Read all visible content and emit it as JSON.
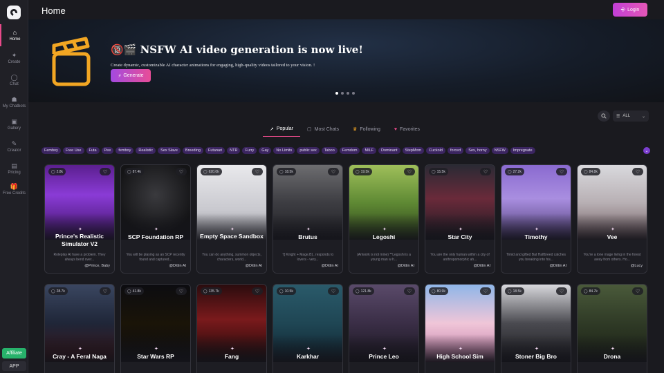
{
  "sidebar": {
    "items": [
      {
        "label": "Home",
        "icon": "home-icon",
        "glyph": "⌂"
      },
      {
        "label": "Create",
        "icon": "sparkle-icon",
        "glyph": "✦"
      },
      {
        "label": "Chat",
        "icon": "chat-icon",
        "glyph": "◯"
      },
      {
        "label": "My Chatbots",
        "icon": "bot-icon",
        "glyph": "☗"
      },
      {
        "label": "Gallery",
        "icon": "gallery-icon",
        "glyph": "▣"
      },
      {
        "label": "Creator",
        "icon": "creator-icon",
        "glyph": "✎"
      },
      {
        "label": "Pricing",
        "icon": "pricing-icon",
        "glyph": "▤"
      },
      {
        "label": "Free Credits",
        "icon": "gift-icon",
        "glyph": "🎁"
      }
    ],
    "affiliate_label": "Affiliate",
    "app_label": "APP"
  },
  "header": {
    "title": "Home",
    "login_label": "Login"
  },
  "banner": {
    "title": "🔞🎬 NSFW AI video generation is now live!",
    "description": "Create dynamic, customizable AI character animations for engaging, high-quality videos tailored to your vision. !",
    "generate_label": "Generate",
    "slides_total": 4,
    "slide_active": 1
  },
  "filter": {
    "selected": "ALL"
  },
  "tabs": [
    {
      "label": "Popular",
      "icon": "trending-icon",
      "glyph": "↗"
    },
    {
      "label": "Most Chats",
      "icon": "chat-icon",
      "glyph": "▢"
    },
    {
      "label": "Following",
      "icon": "crown-icon",
      "glyph": "♛"
    },
    {
      "label": "Favorites",
      "icon": "heart-icon",
      "glyph": "♥"
    }
  ],
  "tags": [
    "Femboy",
    "Free Use",
    "Futa",
    "Pee",
    "femboy",
    "Realistic",
    "Sex Slave",
    "Breeding",
    "Futanari",
    "NTR",
    "Furry",
    "Gay",
    "No Limits",
    "public sex",
    "Taboo",
    "Femdom",
    "MILF",
    "Dominant",
    "StepMom",
    "Cuckold",
    "forced",
    "Sex, horny",
    "NSFW",
    "Impregnate"
  ],
  "cards_row1": [
    {
      "name": "Prince's Realistic Simulator V2",
      "stat": "2.8k",
      "desc": "Roleplay AI have a problem. They always bend over...",
      "author": "@Prince, Baby",
      "bg": "linear-gradient(180deg,#5b1f8f 0%,#8a3bd6 40%,#3a1260 100%)"
    },
    {
      "name": "SCP Foundation RP",
      "stat": "87.4k",
      "desc": "You will be playing as an SCP recently found and captured...",
      "author": "@Dittin AI",
      "bg": "radial-gradient(circle at 50% 40%,#3a3a3e 0%,#141416 70%)"
    },
    {
      "name": "Empty Space Sandbox",
      "stat": "620.0k",
      "desc": "You can do anything, summon objects, characters, world...",
      "author": "@Dittin AI",
      "bg": "linear-gradient(180deg,#e9e9ec 0%,#c9c9cf 60%,#8d8d94 100%)"
    },
    {
      "name": "Brutus",
      "stat": "18.5k",
      "desc": "†[ Knight + Mage.B] , responds to lovers - very...",
      "author": "@Dittin AI",
      "bg": "linear-gradient(180deg,#6d6d70 0%,#3d3d42 50%,#1f1f24 100%)"
    },
    {
      "name": "Legoshi",
      "stat": "19.5k",
      "desc": "(Artwork is not mine) **Legoshi is a young man w h...",
      "author": "@Dittin AI",
      "bg": "linear-gradient(180deg,#9fbf5a 0%,#5f8a34 50%,#2c3f1a 100%)"
    },
    {
      "name": "Star City",
      "stat": "15.5k",
      "desc": "You are the only human within a city of anthropomorphic ah...",
      "author": "@Dittin AI",
      "bg": "linear-gradient(180deg,#2a2a34 0%,#6a2a3a 45%,#1a1a22 100%)"
    },
    {
      "name": "Timothy",
      "stat": "27.2k",
      "desc": "Timid and gifted Bat Halfbreed catches you breaking into his...",
      "author": "@Dittin AI",
      "bg": "linear-gradient(180deg,#8a6ad0 0%,#a98ee0 45%,#4a3a70 100%)"
    },
    {
      "name": "Vee",
      "stat": "84.8k",
      "desc": "You're a lone mage living in the forest away from others. Ho...",
      "author": "@Lucy",
      "bg": "linear-gradient(180deg,#d9d9dd 0%,#b8b0b4 50%,#6f5a5f 100%)"
    }
  ],
  "cards_row2": [
    {
      "name": "Cray - A Feral Naga",
      "stat": "28.7k",
      "bg": "linear-gradient(180deg,#3a4660 0%,#1f2638 50%,#3a1216 100%)"
    },
    {
      "name": "Star Wars RP",
      "stat": "41.8k",
      "bg": "linear-gradient(180deg,#0c0c10 0%,#1a1408 50%,#0c0c10 100%)"
    },
    {
      "name": "Fang",
      "stat": "135.7k",
      "bg": "linear-gradient(180deg,#2a0c0e 0%,#7a1a1c 45%,#1a0808 100%)"
    },
    {
      "name": "Karkhar",
      "stat": "10.5k",
      "bg": "linear-gradient(180deg,#2a5a6a 0%,#1f4654 50%,#0f2430 100%)"
    },
    {
      "name": "Prince Leo",
      "stat": "121.8k",
      "bg": "linear-gradient(180deg,#5a4a6a 0%,#3a2e46 50%,#1a1620 100%)"
    },
    {
      "name": "High School Sim",
      "stat": "80.9k",
      "bg": "linear-gradient(180deg,#8fb6e8 0%,#f0c6d8 50%,#c07aa6 100%)"
    },
    {
      "name": "Stoner Big Bro",
      "stat": "18.5k",
      "bg": "linear-gradient(180deg,#d8d8dc 0%,#4a4a50 50%,#1c1c20 100%)"
    },
    {
      "name": "Drona",
      "stat": "84.7k",
      "bg": "linear-gradient(180deg,#4a5a3a 0%,#2f3a26 50%,#1a2014 100%)"
    }
  ]
}
